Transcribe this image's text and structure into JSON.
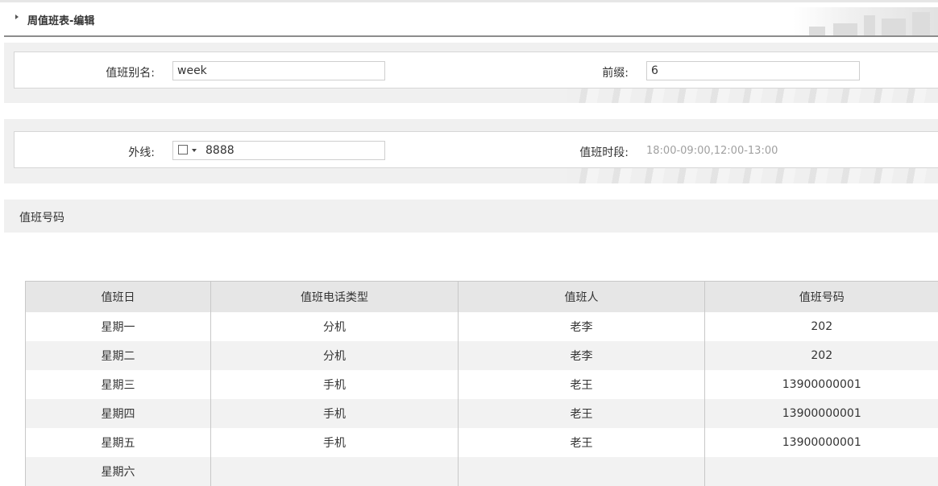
{
  "page": {
    "title": "周值班表-编辑"
  },
  "form": {
    "alias_label": "值班别名:",
    "alias_value": "week",
    "prefix_label": "前缀:",
    "prefix_value": "6",
    "outline_label": "外线:",
    "outline_value": "8888",
    "duty_period_label": "值班时段:",
    "duty_period_value": "18:00-09:00,12:00-13:00"
  },
  "section": {
    "title": "值班号码"
  },
  "table": {
    "headers": [
      "值班日",
      "值班电话类型",
      "值班人",
      "值班号码"
    ],
    "rows": [
      [
        "星期一",
        "分机",
        "老李",
        "202"
      ],
      [
        "星期二",
        "分机",
        "老李",
        "202"
      ],
      [
        "星期三",
        "手机",
        "老王",
        "13900000001"
      ],
      [
        "星期四",
        "手机",
        "老王",
        "13900000001"
      ],
      [
        "星期五",
        "手机",
        "老王",
        "13900000001"
      ],
      [
        "星期六",
        "",
        "",
        ""
      ]
    ]
  },
  "icons": {
    "outline_prefix": "edit-icon",
    "outline_dropdown": "caret-down-icon",
    "collapse": "triangle-right-icon"
  }
}
